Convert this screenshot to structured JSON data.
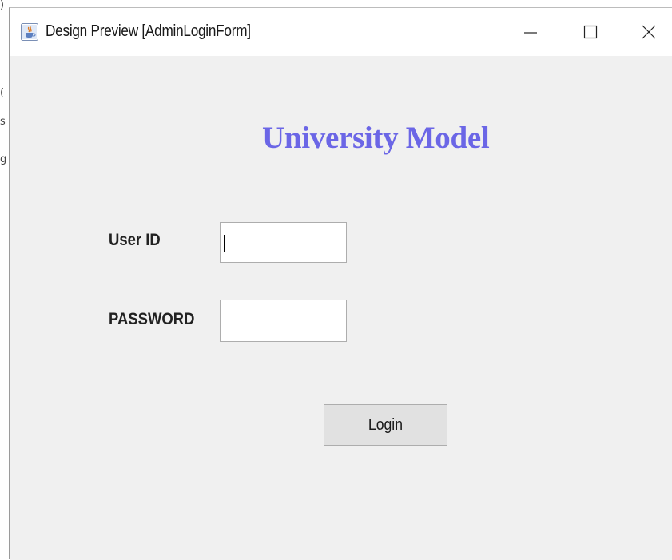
{
  "background": {
    "fragments": [
      ")",
      "(",
      "s",
      "g"
    ]
  },
  "window": {
    "title": "Design Preview [AdminLoginForm]",
    "app_icon": "java-cup-icon",
    "controls": {
      "minimize_icon": "minimize-icon",
      "maximize_icon": "maximize-icon",
      "close_icon": "close-icon"
    }
  },
  "form": {
    "heading": "University Model",
    "heading_color": "#6b66e6",
    "user_id_label": "User ID",
    "user_id_value": "",
    "password_label": "PASSWORD",
    "password_value": "",
    "login_label": "Login"
  }
}
